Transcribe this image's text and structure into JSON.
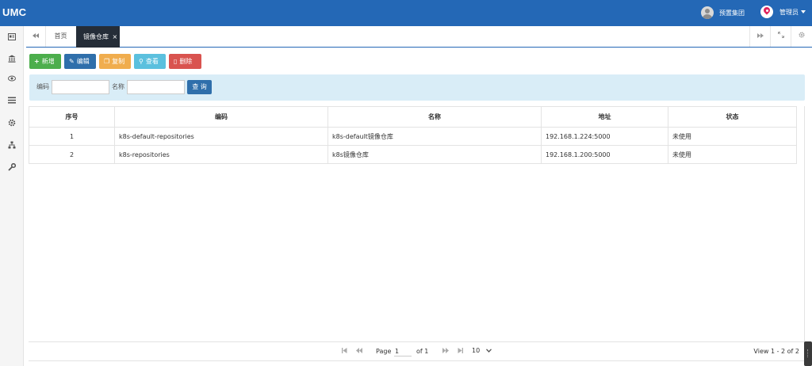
{
  "header": {
    "brand": "UMC",
    "org_label": "预置集团",
    "user_label": "管理员"
  },
  "sidebar": {
    "icons": [
      "id-card-icon",
      "bank-icon",
      "eye-icon",
      "list-icon",
      "gear-icon",
      "sitemap-icon",
      "wrench-icon"
    ]
  },
  "tabs": {
    "home": "首页",
    "active": "镜像仓库",
    "close": "×"
  },
  "toolbar": {
    "add": "新增",
    "edit": "编辑",
    "copy": "复制",
    "view": "查看",
    "delete": "删除"
  },
  "search": {
    "code_label": "编码",
    "code_value": "",
    "name_label": "名称",
    "name_value": "",
    "button": "查 询"
  },
  "table": {
    "columns": [
      "序号",
      "编码",
      "名称",
      "地址",
      "状态"
    ],
    "rows": [
      [
        "1",
        "k8s-default-repositories",
        "k8s-default镜像仓库",
        "192.168.1.224:5000",
        "未使用"
      ],
      [
        "2",
        "k8s-repositories",
        "k8s镜像仓库",
        "192.168.1.200:5000",
        "未使用"
      ]
    ]
  },
  "pager": {
    "page_label": "Page",
    "page_value": "1",
    "of_label": "of 1",
    "page_size": "10",
    "view_text": "View 1 - 2 of 2"
  },
  "colors": {
    "header": "#2468b6",
    "active_tab": "#252d38",
    "add": "#4cae4c",
    "edit": "#2f6fab",
    "copy": "#f0ad4e",
    "view": "#5bc0de",
    "delete": "#d9534f",
    "search_panel": "#d9edf7"
  }
}
